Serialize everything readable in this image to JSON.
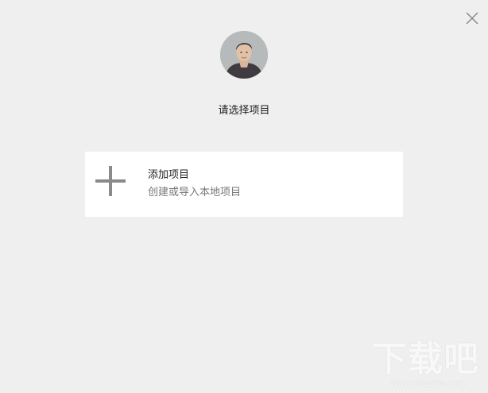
{
  "header": {
    "prompt_text": "请选择项目"
  },
  "add_project": {
    "title": "添加项目",
    "subtitle": "创建或导入本地项目"
  },
  "watermark": {
    "brand": "下载吧",
    "url": "www.xiazaiba.com"
  },
  "icons": {
    "close": "close-icon",
    "plus": "plus-icon",
    "avatar": "user-avatar"
  },
  "colors": {
    "background": "#efefef",
    "card": "#ffffff",
    "plus": "#8a8a8a",
    "close": "#8a8a8a"
  }
}
